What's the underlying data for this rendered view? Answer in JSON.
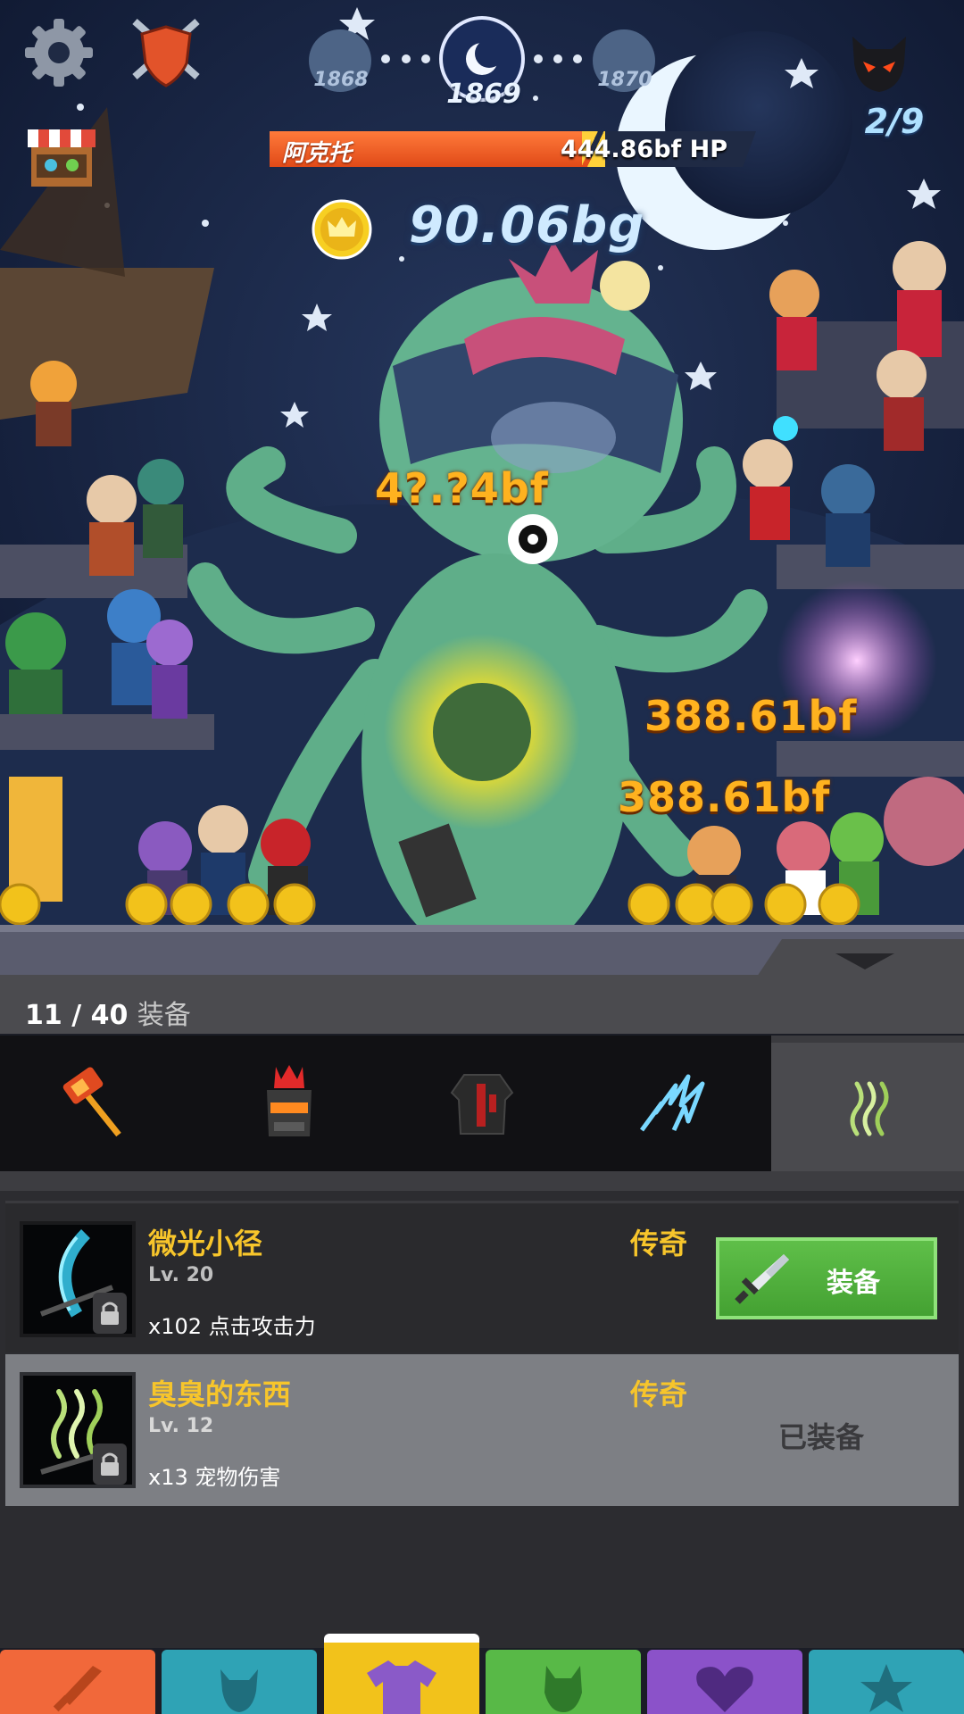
{
  "hud": {
    "settings_icon": "gear-icon",
    "guild_icon": "shield-swords-icon",
    "shop_icon": "shop-stall-icon",
    "boss_icon": "devil-head-icon",
    "stages": [
      "1868",
      "1869",
      "1870"
    ],
    "boss_count": "2/9"
  },
  "boss": {
    "name": "阿克托",
    "hp": "444.86bf HP",
    "hp_fraction": 0.66
  },
  "gold": {
    "icon": "crown-coin-icon",
    "amount": "90.06bg"
  },
  "damage_popups": [
    "4?.?4bf",
    "388.61bf",
    "388.61bf"
  ],
  "equipment": {
    "count": "11 / 40",
    "count_word": "装备",
    "categories": [
      {
        "icon": "hammer-weapon-icon"
      },
      {
        "icon": "helmet-icon"
      },
      {
        "icon": "armor-icon"
      },
      {
        "icon": "lightning-icon"
      },
      {
        "icon": "stench-aura-icon",
        "active": true
      }
    ],
    "items": [
      {
        "name": "微光小径",
        "level": "Lv. 20",
        "effect": "x102 点击攻击力",
        "rarity": "传奇",
        "action": "装备",
        "icon": "shimmer-path-icon"
      },
      {
        "name": "臭臭的东西",
        "level": "Lv. 12",
        "effect": "x13 宠物伤害",
        "rarity": "传奇",
        "status": "已装备",
        "icon": "stinky-thing-icon"
      }
    ]
  },
  "nav": [
    {
      "icon": "sword-icon",
      "color": "#f1683a"
    },
    {
      "icon": "hero-icon",
      "color": "#2fa3b5"
    },
    {
      "icon": "shirt-icon",
      "color": "#f2c21b",
      "active": true
    },
    {
      "icon": "pet-icon",
      "color": "#58b947"
    },
    {
      "icon": "heart-icon",
      "color": "#8b52c9"
    },
    {
      "icon": "star-icon",
      "color": "#2fa3b5"
    }
  ],
  "colors": {
    "gold_text": "#f7c52b",
    "equip_button": "#4caf3a",
    "hp_bar": "#e8562a"
  }
}
